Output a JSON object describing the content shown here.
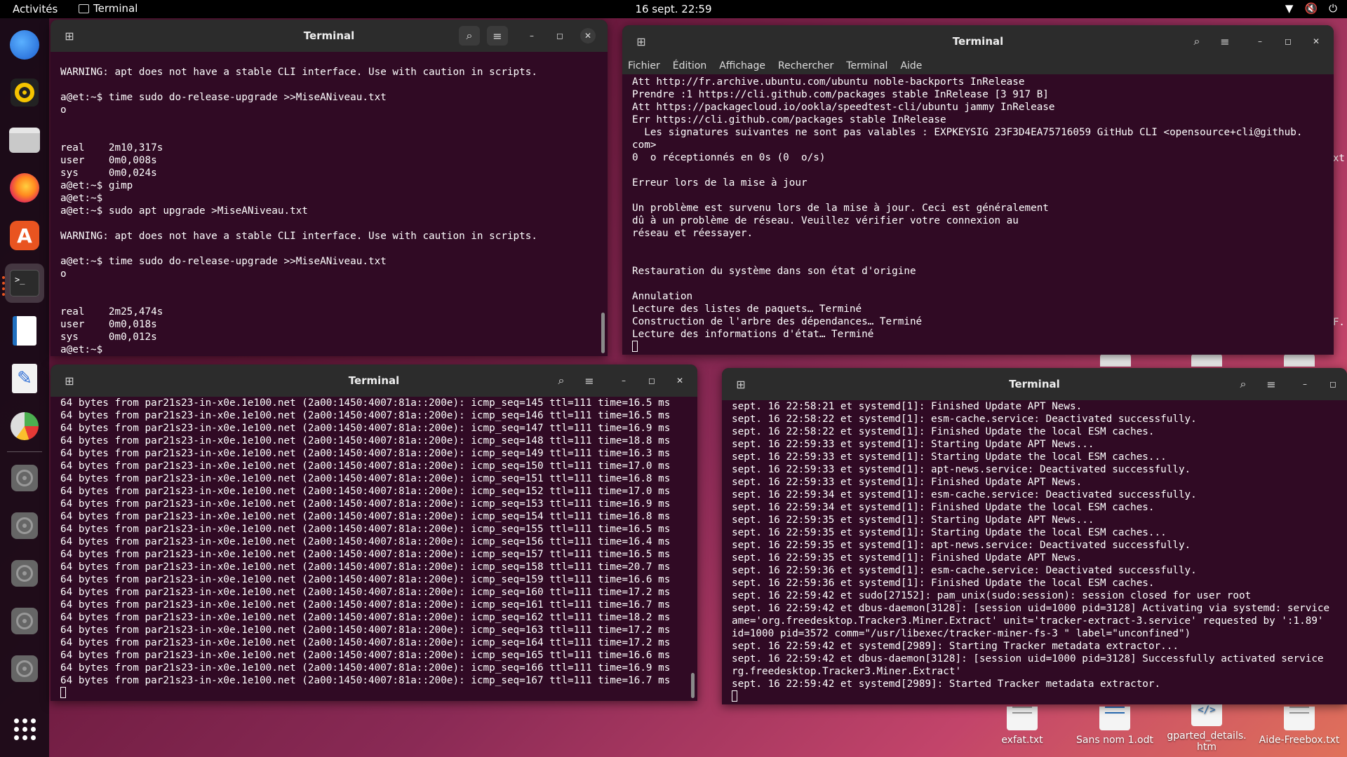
{
  "topbar": {
    "activities": "Activités",
    "app_name": "Terminal",
    "clock": "16 sept.  22:59",
    "tray_icons": [
      "wifi-icon",
      "volume-muted-icon",
      "power-icon"
    ]
  },
  "dock": {
    "items": [
      {
        "name": "thunderbird",
        "icon": "mail-icon"
      },
      {
        "name": "rhythmbox",
        "icon": "music-icon"
      },
      {
        "name": "files",
        "icon": "folder-icon"
      },
      {
        "name": "firefox",
        "icon": "browser-icon"
      },
      {
        "name": "app-center",
        "icon": "store-icon"
      },
      {
        "name": "terminal",
        "icon": "terminal-icon"
      },
      {
        "name": "libreoffice-writer",
        "icon": "document-icon"
      },
      {
        "name": "text-editor",
        "icon": "pencil-icon"
      },
      {
        "name": "disk-usage",
        "icon": "pie-icon"
      },
      {
        "name": "disk-1",
        "icon": "disk-icon"
      },
      {
        "name": "disk-2",
        "icon": "disk-icon"
      },
      {
        "name": "disk-3",
        "icon": "disk-icon"
      },
      {
        "name": "disk-4",
        "icon": "disk-icon"
      },
      {
        "name": "disk-5",
        "icon": "disk-icon"
      }
    ],
    "apps_grid": "apps-grid-icon"
  },
  "windows": {
    "w1": {
      "title": "Terminal",
      "lines": [
        "WARNING: apt does not have a stable CLI interface. Use with caution in scripts.",
        "",
        "a@et:~$ time sudo do-release-upgrade >>MiseANiveau.txt",
        "o",
        "",
        "",
        "real    2m10,317s",
        "user    0m0,008s",
        "sys     0m0,024s",
        "a@et:~$ gimp",
        "a@et:~$",
        "a@et:~$ sudo apt upgrade >MiseANiveau.txt",
        "",
        "WARNING: apt does not have a stable CLI interface. Use with caution in scripts.",
        "",
        "a@et:~$ time sudo do-release-upgrade >>MiseANiveau.txt",
        "o",
        "",
        "",
        "real    2m25,474s",
        "user    0m0,018s",
        "sys     0m0,012s",
        "a@et:~$"
      ]
    },
    "w2": {
      "title": "Terminal",
      "menu": [
        "Fichier",
        "Édition",
        "Affichage",
        "Rechercher",
        "Terminal",
        "Aide"
      ],
      "lines": [
        "Att http://fr.archive.ubuntu.com/ubuntu noble-backports InRelease",
        "Prendre :1 https://cli.github.com/packages stable InRelease [3 917 B]",
        "Att https://packagecloud.io/ookla/speedtest-cli/ubuntu jammy InRelease",
        "Err https://cli.github.com/packages stable InRelease",
        "  Les signatures suivantes ne sont pas valables : EXPKEYSIG 23F3D4EA75716059 GitHub CLI <opensource+cli@github.",
        "com>",
        "0  o réceptionnés en 0s (0  o/s)",
        "",
        "Erreur lors de la mise à jour",
        "",
        "Un problème est survenu lors de la mise à jour. Ceci est généralement",
        "dû à un problème de réseau. Veuillez vérifier votre connexion au",
        "réseau et réessayer.",
        "",
        "",
        "Restauration du système dans son état d'origine",
        "",
        "Annulation",
        "Lecture des listes de paquets… Terminé",
        "Construction de l'arbre des dépendances… Terminé",
        "Lecture des informations d'état… Terminé"
      ]
    },
    "w3": {
      "title": "Terminal",
      "lines": [
        "64 bytes from par21s23-in-x0e.1e100.net (2a00:1450:4007:81a::200e): icmp_seq=145 ttl=111 time=16.5 ms",
        "64 bytes from par21s23-in-x0e.1e100.net (2a00:1450:4007:81a::200e): icmp_seq=146 ttl=111 time=16.5 ms",
        "64 bytes from par21s23-in-x0e.1e100.net (2a00:1450:4007:81a::200e): icmp_seq=147 ttl=111 time=16.9 ms",
        "64 bytes from par21s23-in-x0e.1e100.net (2a00:1450:4007:81a::200e): icmp_seq=148 ttl=111 time=18.8 ms",
        "64 bytes from par21s23-in-x0e.1e100.net (2a00:1450:4007:81a::200e): icmp_seq=149 ttl=111 time=16.3 ms",
        "64 bytes from par21s23-in-x0e.1e100.net (2a00:1450:4007:81a::200e): icmp_seq=150 ttl=111 time=17.0 ms",
        "64 bytes from par21s23-in-x0e.1e100.net (2a00:1450:4007:81a::200e): icmp_seq=151 ttl=111 time=16.8 ms",
        "64 bytes from par21s23-in-x0e.1e100.net (2a00:1450:4007:81a::200e): icmp_seq=152 ttl=111 time=17.0 ms",
        "64 bytes from par21s23-in-x0e.1e100.net (2a00:1450:4007:81a::200e): icmp_seq=153 ttl=111 time=16.9 ms",
        "64 bytes from par21s23-in-x0e.1e100.net (2a00:1450:4007:81a::200e): icmp_seq=154 ttl=111 time=16.8 ms",
        "64 bytes from par21s23-in-x0e.1e100.net (2a00:1450:4007:81a::200e): icmp_seq=155 ttl=111 time=16.5 ms",
        "64 bytes from par21s23-in-x0e.1e100.net (2a00:1450:4007:81a::200e): icmp_seq=156 ttl=111 time=16.4 ms",
        "64 bytes from par21s23-in-x0e.1e100.net (2a00:1450:4007:81a::200e): icmp_seq=157 ttl=111 time=16.5 ms",
        "64 bytes from par21s23-in-x0e.1e100.net (2a00:1450:4007:81a::200e): icmp_seq=158 ttl=111 time=20.7 ms",
        "64 bytes from par21s23-in-x0e.1e100.net (2a00:1450:4007:81a::200e): icmp_seq=159 ttl=111 time=16.6 ms",
        "64 bytes from par21s23-in-x0e.1e100.net (2a00:1450:4007:81a::200e): icmp_seq=160 ttl=111 time=17.2 ms",
        "64 bytes from par21s23-in-x0e.1e100.net (2a00:1450:4007:81a::200e): icmp_seq=161 ttl=111 time=16.7 ms",
        "64 bytes from par21s23-in-x0e.1e100.net (2a00:1450:4007:81a::200e): icmp_seq=162 ttl=111 time=18.2 ms",
        "64 bytes from par21s23-in-x0e.1e100.net (2a00:1450:4007:81a::200e): icmp_seq=163 ttl=111 time=17.2 ms",
        "64 bytes from par21s23-in-x0e.1e100.net (2a00:1450:4007:81a::200e): icmp_seq=164 ttl=111 time=17.2 ms",
        "64 bytes from par21s23-in-x0e.1e100.net (2a00:1450:4007:81a::200e): icmp_seq=165 ttl=111 time=16.6 ms",
        "64 bytes from par21s23-in-x0e.1e100.net (2a00:1450:4007:81a::200e): icmp_seq=166 ttl=111 time=16.9 ms",
        "64 bytes from par21s23-in-x0e.1e100.net (2a00:1450:4007:81a::200e): icmp_seq=167 ttl=111 time=16.7 ms"
      ]
    },
    "w4": {
      "title": "Terminal",
      "lines": [
        "sept. 16 22:58:21 et systemd[1]: Finished Update APT News.",
        "sept. 16 22:58:22 et systemd[1]: esm-cache.service: Deactivated successfully.",
        "sept. 16 22:58:22 et systemd[1]: Finished Update the local ESM caches.",
        "sept. 16 22:59:33 et systemd[1]: Starting Update APT News...",
        "sept. 16 22:59:33 et systemd[1]: Starting Update the local ESM caches...",
        "sept. 16 22:59:33 et systemd[1]: apt-news.service: Deactivated successfully.",
        "sept. 16 22:59:33 et systemd[1]: Finished Update APT News.",
        "sept. 16 22:59:34 et systemd[1]: esm-cache.service: Deactivated successfully.",
        "sept. 16 22:59:34 et systemd[1]: Finished Update the local ESM caches.",
        "sept. 16 22:59:35 et systemd[1]: Starting Update APT News...",
        "sept. 16 22:59:35 et systemd[1]: Starting Update the local ESM caches...",
        "sept. 16 22:59:35 et systemd[1]: apt-news.service: Deactivated successfully.",
        "sept. 16 22:59:35 et systemd[1]: Finished Update APT News.",
        "sept. 16 22:59:36 et systemd[1]: esm-cache.service: Deactivated successfully.",
        "sept. 16 22:59:36 et systemd[1]: Finished Update the local ESM caches.",
        "sept. 16 22:59:42 et sudo[27152]: pam_unix(sudo:session): session closed for user root",
        "sept. 16 22:59:42 et dbus-daemon[3128]: [session uid=1000 pid=3128] Activating via systemd: service",
        "ame='org.freedesktop.Tracker3.Miner.Extract' unit='tracker-extract-3.service' requested by ':1.89'",
        "id=1000 pid=3572 comm=\"/usr/libexec/tracker-miner-fs-3 \" label=\"unconfined\")",
        "sept. 16 22:59:42 et systemd[2989]: Starting Tracker metadata extractor...",
        "sept. 16 22:59:42 et dbus-daemon[3128]: [session uid=1000 pid=3128] Successfully activated service",
        "rg.freedesktop.Tracker3.Miner.Extract'",
        "sept. 16 22:59:42 et systemd[2989]: Started Tracker metadata extractor."
      ]
    }
  },
  "desktop": {
    "icons": [
      {
        "label": "exfat.txt"
      },
      {
        "label": "Sans nom 1.odt"
      },
      {
        "label": "gparted_details.htm"
      },
      {
        "label": "Aide-Freebox.txt"
      }
    ],
    "edge_fragments": [
      "xt",
      "F."
    ]
  }
}
